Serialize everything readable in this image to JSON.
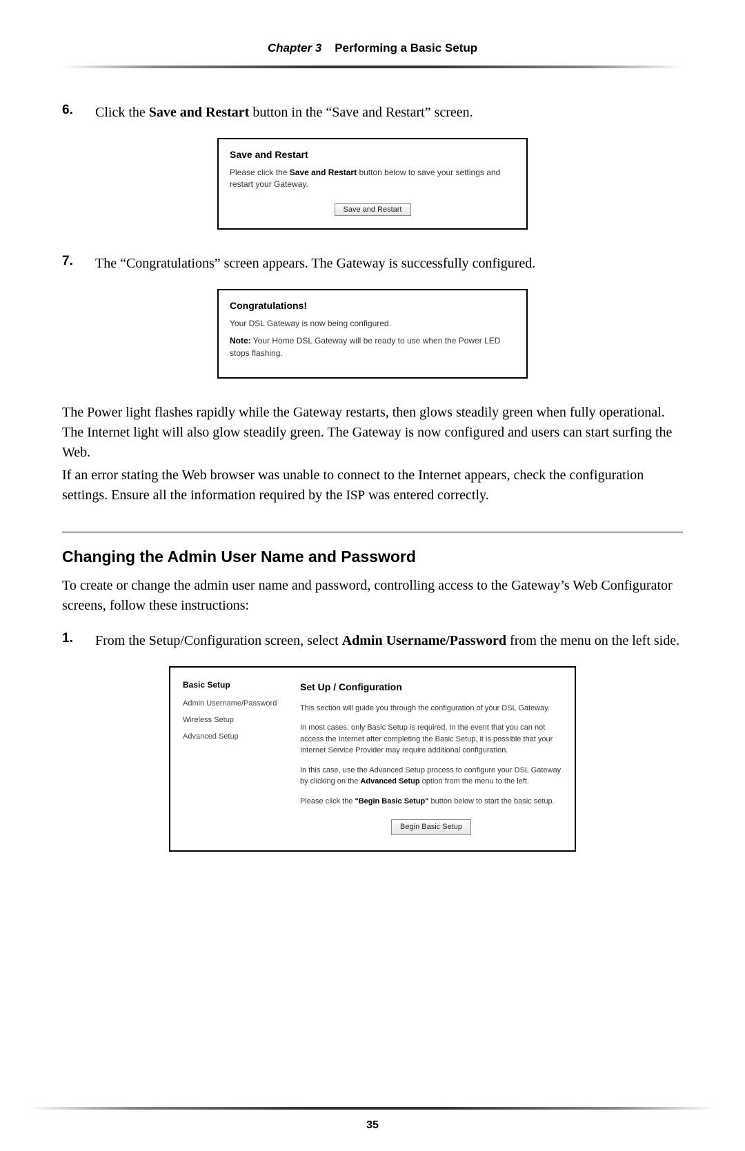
{
  "header": {
    "chapter_prefix": "Chapter 3",
    "chapter_title": "Performing a Basic Setup"
  },
  "step6": {
    "num": "6.",
    "text_plain_1": "Click the ",
    "text_bold": "Save and Restart",
    "text_plain_2": " button in the “Save and Restart” screen."
  },
  "box1": {
    "title": "Save and Restart",
    "line1a": "Please click the ",
    "line1b": "Save and Restart",
    "line1c": " button below to save your settings and restart your Gateway.",
    "button": "Save and Restart"
  },
  "step7": {
    "num": "7.",
    "text": "The “Congratulations” screen appears. The Gateway is successfully configured."
  },
  "box2": {
    "title": "Congratulations!",
    "line1": "Your DSL Gateway is now being configured.",
    "note_label": "Note:",
    "note_text": " Your Home DSL Gateway will be ready to use when the Power LED stops flashing."
  },
  "para1": "The Power light flashes rapidly while the Gateway restarts, then glows steadily green when fully operational. The Internet light will also glow steadily green. The Gateway is now configured and users can start surfing the Web.",
  "para2a": "If an error stating the Web browser was unable to connect to the Internet appears, check the configuration settings. Ensure all the information required by the ",
  "para2_isp": "ISP",
  "para2b": " was entered correctly.",
  "section_heading": "Changing the Admin User Name and Password",
  "para3": "To create or change the admin user name and password, controlling access to the Gateway’s Web Configurator screens, follow these instructions:",
  "step1": {
    "num": "1.",
    "text_a": "From the Setup/Configuration screen, select ",
    "text_bold": "Admin Username/Password",
    "text_b": " from the menu on the left side."
  },
  "box3": {
    "sidebar": {
      "head": "Basic Setup",
      "items": [
        "Admin Username/Password",
        "Wireless Setup",
        "Advanced Setup"
      ]
    },
    "content": {
      "head": "Set Up / Configuration",
      "p1": "This section will guide you through the configuration of your DSL Gateway.",
      "p2": "In most cases, only Basic Setup is required. In the event that you can not access the Internet after completing the Basic Setup, it is possible that your Internet Service Provider may require additional configuration.",
      "p3a": "In this case, use the Advanced Setup process to configure your DSL Gateway by clicking on the ",
      "p3b": "Advanced Setup",
      "p3c": " option from the menu to the left.",
      "p4a": "Please click the ",
      "p4b": "\"Begin Basic Setup\"",
      "p4c": " button below to start the basic setup.",
      "button": "Begin Basic Setup"
    }
  },
  "page_number": "35"
}
